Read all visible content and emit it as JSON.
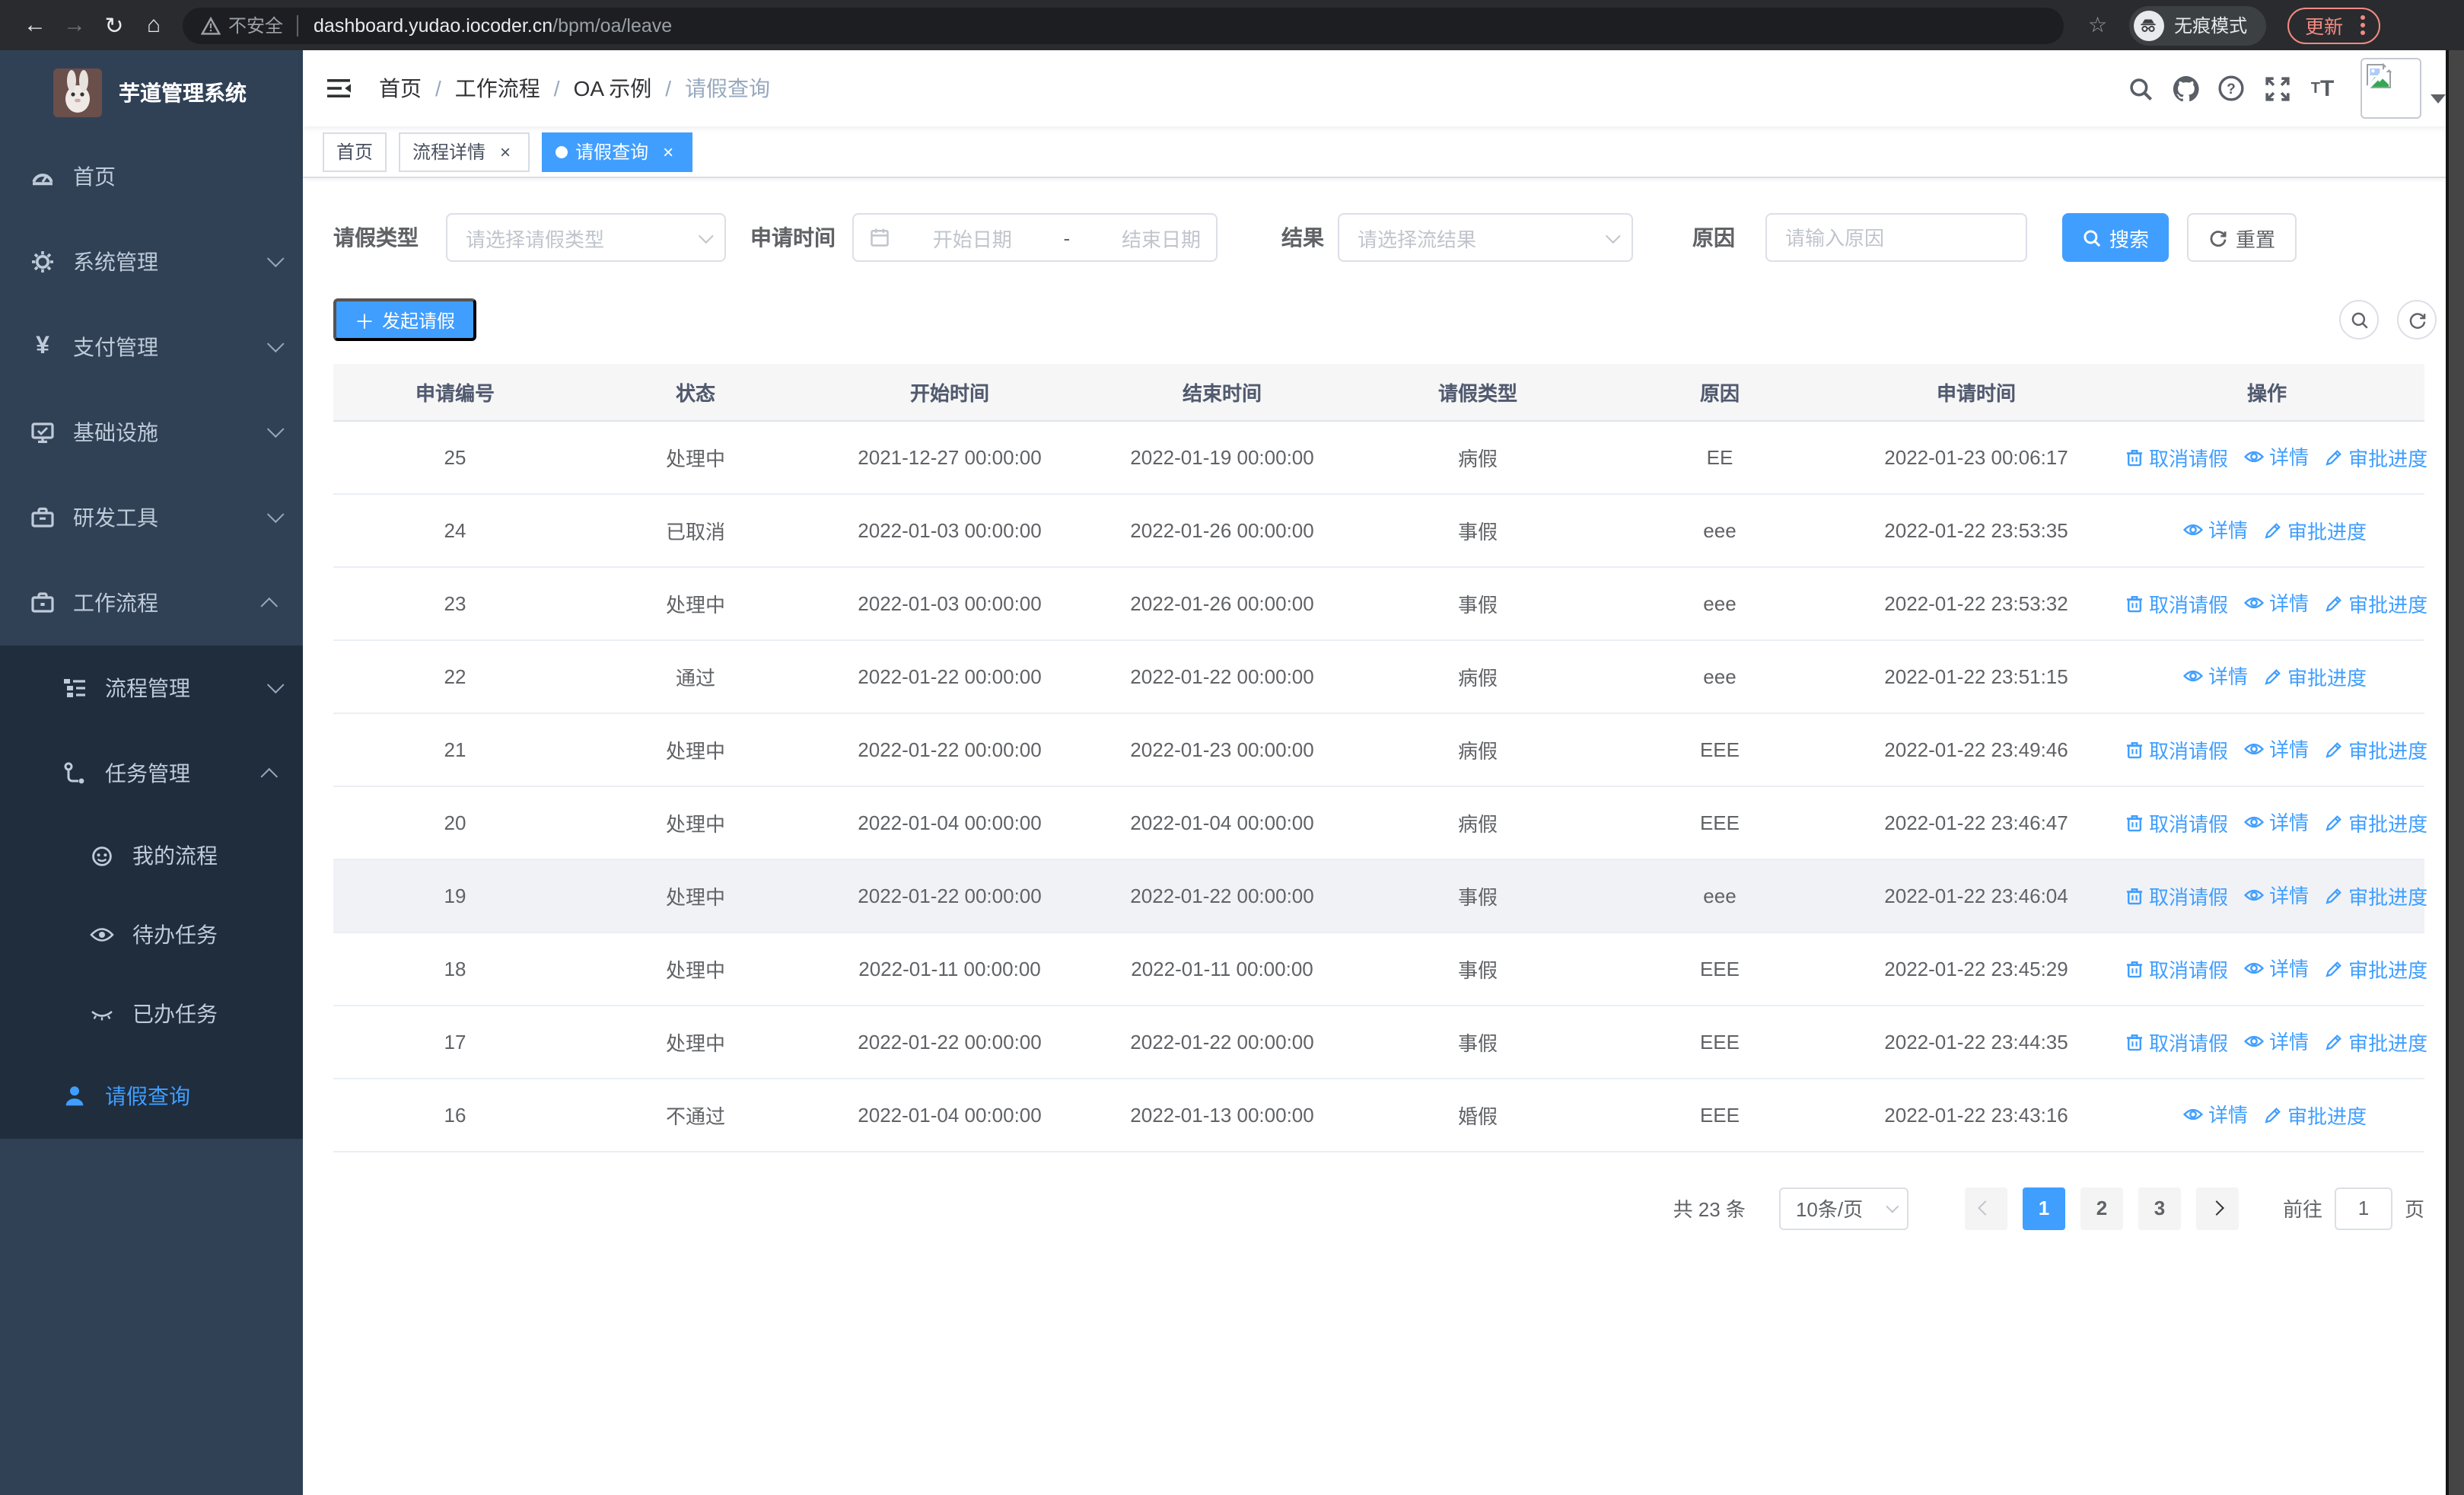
{
  "browser": {
    "security_label": "不安全",
    "url_host": "dashboard.yudao.iocoder.cn",
    "url_path": "/bpm/oa/leave",
    "incognito_label": "无痕模式",
    "update_label": "更新"
  },
  "sidebar": {
    "logo_title": "芋道管理系统",
    "items": {
      "home": "首页",
      "system": "系统管理",
      "pay": "支付管理",
      "infra": "基础设施",
      "dev": "研发工具",
      "workflow": "工作流程",
      "process": "流程管理",
      "task": "任务管理",
      "my_process": "我的流程",
      "todo": "待办任务",
      "done": "已办任务",
      "leave": "请假查询"
    }
  },
  "breadcrumb": {
    "separator": "/",
    "items": [
      "首页",
      "工作流程",
      "OA 示例",
      "请假查询"
    ]
  },
  "tabs": [
    {
      "label": "首页"
    },
    {
      "label": "流程详情"
    },
    {
      "label": "请假查询"
    }
  ],
  "filters": {
    "leave_type_label": "请假类型",
    "leave_type_placeholder": "请选择请假类型",
    "apply_time_label": "申请时间",
    "date_start_placeholder": "开始日期",
    "date_separator": "-",
    "date_end_placeholder": "结束日期",
    "result_label": "结果",
    "result_placeholder": "请选择流结果",
    "reason_label": "原因",
    "reason_placeholder": "请输入原因",
    "search_label": "搜索",
    "reset_label": "重置"
  },
  "toolbar": {
    "create_label": "发起请假"
  },
  "table": {
    "columns": [
      "申请编号",
      "状态",
      "开始时间",
      "结束时间",
      "请假类型",
      "原因",
      "申请时间",
      "操作"
    ],
    "action_labels": {
      "cancel": "取消请假",
      "detail": "详情",
      "progress": "审批进度"
    },
    "rows": [
      {
        "id": "25",
        "status": "处理中",
        "start": "2021-12-27 00:00:00",
        "end": "2022-01-19 00:00:00",
        "type": "病假",
        "reason": "EE",
        "applyTime": "2022-01-23 00:06:17",
        "actions": [
          "cancel",
          "detail",
          "progress"
        ],
        "highlight": false
      },
      {
        "id": "24",
        "status": "已取消",
        "start": "2022-01-03 00:00:00",
        "end": "2022-01-26 00:00:00",
        "type": "事假",
        "reason": "eee",
        "applyTime": "2022-01-22 23:53:35",
        "actions": [
          "detail",
          "progress"
        ],
        "highlight": false
      },
      {
        "id": "23",
        "status": "处理中",
        "start": "2022-01-03 00:00:00",
        "end": "2022-01-26 00:00:00",
        "type": "事假",
        "reason": "eee",
        "applyTime": "2022-01-22 23:53:32",
        "actions": [
          "cancel",
          "detail",
          "progress"
        ],
        "highlight": false
      },
      {
        "id": "22",
        "status": "通过",
        "start": "2022-01-22 00:00:00",
        "end": "2022-01-22 00:00:00",
        "type": "病假",
        "reason": "eee",
        "applyTime": "2022-01-22 23:51:15",
        "actions": [
          "detail",
          "progress"
        ],
        "highlight": false
      },
      {
        "id": "21",
        "status": "处理中",
        "start": "2022-01-22 00:00:00",
        "end": "2022-01-23 00:00:00",
        "type": "病假",
        "reason": "EEE",
        "applyTime": "2022-01-22 23:49:46",
        "actions": [
          "cancel",
          "detail",
          "progress"
        ],
        "highlight": false
      },
      {
        "id": "20",
        "status": "处理中",
        "start": "2022-01-04 00:00:00",
        "end": "2022-01-04 00:00:00",
        "type": "病假",
        "reason": "EEE",
        "applyTime": "2022-01-22 23:46:47",
        "actions": [
          "cancel",
          "detail",
          "progress"
        ],
        "highlight": false
      },
      {
        "id": "19",
        "status": "处理中",
        "start": "2022-01-22 00:00:00",
        "end": "2022-01-22 00:00:00",
        "type": "事假",
        "reason": "eee",
        "applyTime": "2022-01-22 23:46:04",
        "actions": [
          "cancel",
          "detail",
          "progress"
        ],
        "highlight": true
      },
      {
        "id": "18",
        "status": "处理中",
        "start": "2022-01-11 00:00:00",
        "end": "2022-01-11 00:00:00",
        "type": "事假",
        "reason": "EEE",
        "applyTime": "2022-01-22 23:45:29",
        "actions": [
          "cancel",
          "detail",
          "progress"
        ],
        "highlight": false
      },
      {
        "id": "17",
        "status": "处理中",
        "start": "2022-01-22 00:00:00",
        "end": "2022-01-22 00:00:00",
        "type": "事假",
        "reason": "EEE",
        "applyTime": "2022-01-22 23:44:35",
        "actions": [
          "cancel",
          "detail",
          "progress"
        ],
        "highlight": false
      },
      {
        "id": "16",
        "status": "不通过",
        "start": "2022-01-04 00:00:00",
        "end": "2022-01-13 00:00:00",
        "type": "婚假",
        "reason": "EEE",
        "applyTime": "2022-01-22 23:43:16",
        "actions": [
          "detail",
          "progress"
        ],
        "highlight": false
      }
    ]
  },
  "pagination": {
    "total": "共 23 条",
    "page_size": "10条/页",
    "pages": [
      "1",
      "2",
      "3"
    ],
    "active_page": "1",
    "goto_label": "前往",
    "goto_value": "1",
    "goto_suffix": "页"
  },
  "colors": {
    "accent": "#409eff",
    "sidebar_bg": "#304156",
    "submenu_bg": "#1f2d3d",
    "update_badge": "#f28b82"
  }
}
